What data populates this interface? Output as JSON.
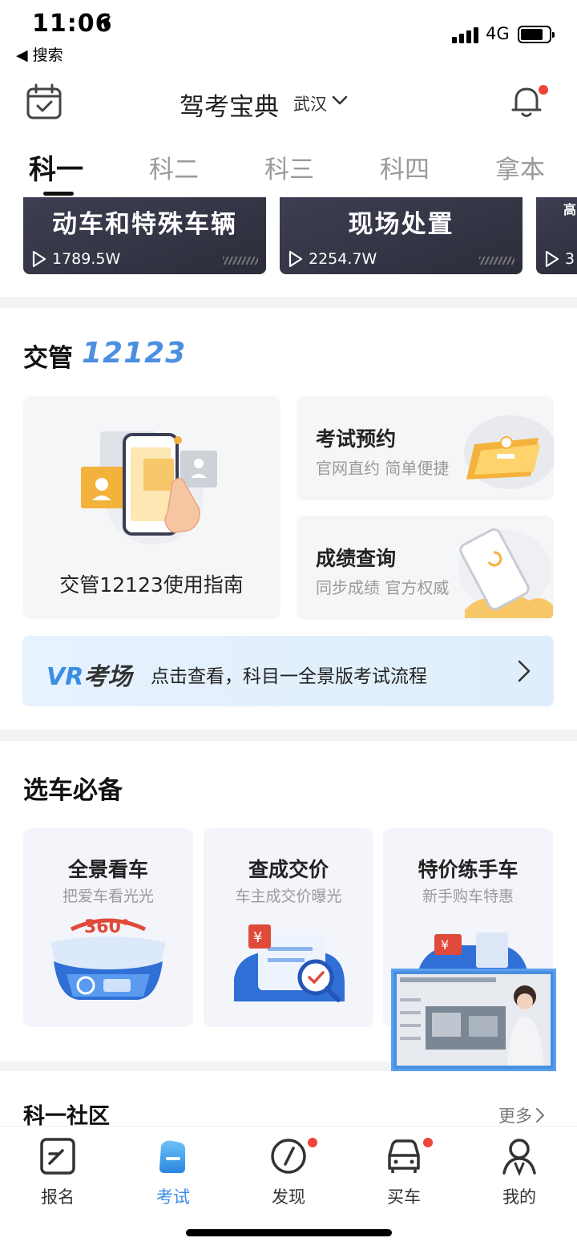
{
  "status_bar": {
    "time": "11:06",
    "back_label": "◀ 搜索",
    "network": "4G"
  },
  "header": {
    "title": "驾考宝典",
    "city": "武汉"
  },
  "tabs": [
    {
      "label": "科一",
      "active": true
    },
    {
      "label": "科二"
    },
    {
      "label": "科三"
    },
    {
      "label": "科四"
    },
    {
      "label": "拿本"
    }
  ],
  "video_cards": [
    {
      "title": "动车和特殊车辆",
      "plays": "1789.5W"
    },
    {
      "title": "现场处置",
      "plays": "2254.7W"
    },
    {
      "title": "高",
      "plays": "3"
    }
  ],
  "traffic": {
    "title_prefix": "交管",
    "title_brand": "12123",
    "guide_label": "交管12123使用指南",
    "exam_booking": {
      "title": "考试预约",
      "subtitle": "官网直约 简单便捷"
    },
    "score_query": {
      "title": "成绩查询",
      "subtitle": "同步成绩 官方权威"
    }
  },
  "vr_banner": {
    "logo_vr": "VR",
    "logo_text": "考场",
    "text": "点击查看，科目一全景版考试流程"
  },
  "car_section": {
    "title": "选车必备",
    "cards": [
      {
        "title": "全景看车",
        "subtitle": "把爱车看光光",
        "badge": "360°"
      },
      {
        "title": "查成交价",
        "subtitle": "车主成交价曝光",
        "badge": "¥"
      },
      {
        "title": "特价练手车",
        "subtitle": "新手购车特惠",
        "badge": "¥"
      }
    ]
  },
  "community": {
    "title": "科一社区",
    "more": "更多"
  },
  "bottom_nav": [
    {
      "label": "报名",
      "badge": false
    },
    {
      "label": "考试",
      "badge": false,
      "active": true
    },
    {
      "label": "发现",
      "badge": true
    },
    {
      "label": "买车",
      "badge": true
    },
    {
      "label": "我的",
      "badge": false
    }
  ],
  "colors": {
    "accent": "#3a8ee6",
    "badge_red": "#f0433a",
    "video_card_bg": "#34364a"
  }
}
